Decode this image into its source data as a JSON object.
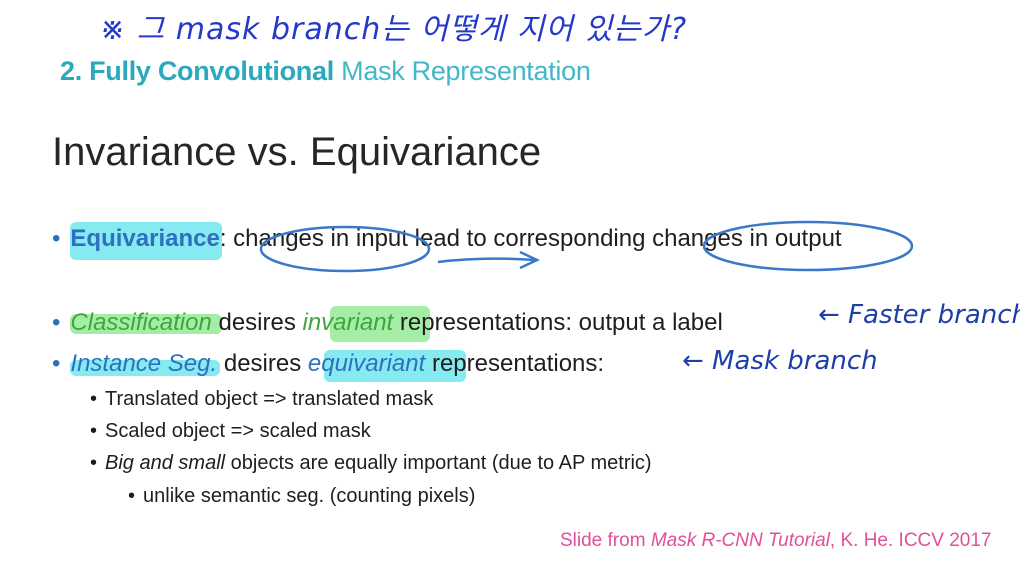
{
  "annotation_top": "※ 그 mask branch는 어떻게 지어 있는가?",
  "section_title": {
    "strong": "2. Fully Convolutional",
    "rest": " Mask Representation"
  },
  "slide_title": "Invariance vs. Equivariance",
  "bullets": {
    "b1": {
      "term": "Equivariance",
      "text": ": changes in input lead to corresponding changes in output"
    },
    "b2": {
      "term": "Classification",
      "pre": " desires ",
      "kw": "invariant",
      "post": " representations: output a label"
    },
    "b3": {
      "term": "Instance Seg.",
      "pre": " desires ",
      "kw": "equivariant",
      "post": " representations:"
    },
    "sub1": "Translated object => translated mask",
    "sub2": "Scaled object => scaled mask",
    "sub3_italic": "Big and small",
    "sub3_rest": " objects are equally important (due to AP metric)",
    "subsub1": "unlike semantic seg. (counting pixels)"
  },
  "annotations": {
    "faster": "← Faster branch",
    "mask": "← Mask  branch"
  },
  "credit": {
    "pre": "Slide from ",
    "italic": "Mask R-CNN Tutorial",
    "post": ", K. He. ICCV 2017"
  },
  "colors": {
    "highlight_cyan": "#22d8e6",
    "highlight_green": "#57e05a",
    "ink": "#1f3fa8"
  }
}
